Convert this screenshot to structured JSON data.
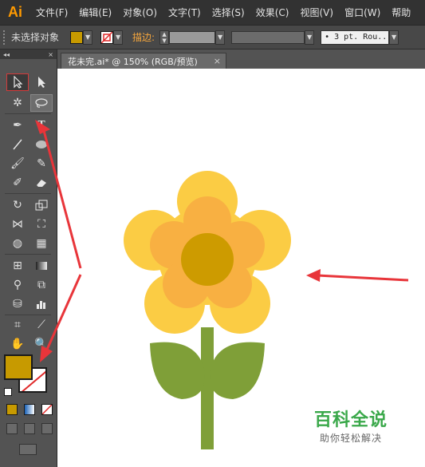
{
  "app": {
    "logo": "Ai"
  },
  "menu": [
    "文件(F)",
    "编辑(E)",
    "对象(O)",
    "文字(T)",
    "选择(S)",
    "效果(C)",
    "视图(V)",
    "窗口(W)",
    "帮助"
  ],
  "control": {
    "selection_label": "未选择对象",
    "fill_color": "#c79a00",
    "stroke_label": "描边:",
    "brush_value": "• 3 pt. Rou..."
  },
  "document": {
    "tab_title": "花未完.ai* @ 150% (RGB/预览)",
    "close": "×"
  },
  "toolbox": {
    "collapse": "◂◂",
    "close": "×"
  },
  "colors": {
    "petal_outer": "#fbcc44",
    "petal_inner": "#f8b042",
    "center": "#cd9b00",
    "stem": "#7f9f38",
    "arrow": "#e8353a",
    "fill_swatch": "#c79a00"
  },
  "watermark": {
    "title": "百科全说",
    "subtitle": "助你轻松解决"
  }
}
